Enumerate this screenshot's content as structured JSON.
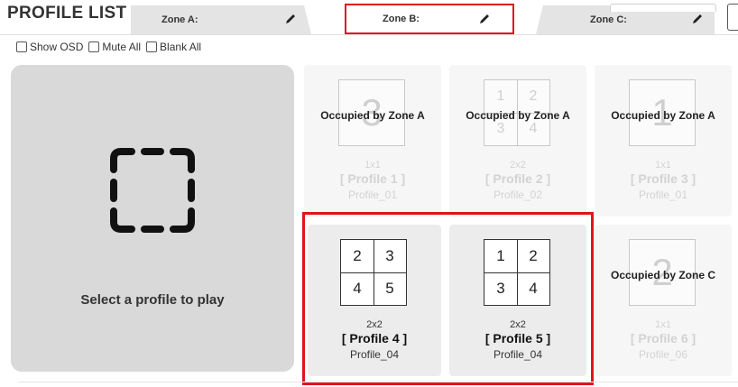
{
  "header": {
    "title": "PROFILE LIST"
  },
  "tabs": [
    {
      "label": "Zone A:"
    },
    {
      "label": "Zone B:"
    },
    {
      "label": "Zone C:"
    }
  ],
  "options": [
    {
      "label": "Show OSD",
      "checked": false
    },
    {
      "label": "Mute All",
      "checked": false
    },
    {
      "label": "Blank All",
      "checked": false
    }
  ],
  "player": {
    "caption": "Select a profile to play",
    "icon": "dashed-frame-icon"
  },
  "profiles": [
    {
      "name": "[ Profile 1 ]",
      "layout": "1x1",
      "sub": "Profile_01",
      "status": "Occupied by Zone A",
      "cells": [
        "3"
      ]
    },
    {
      "name": "[ Profile 2 ]",
      "layout": "2x2",
      "sub": "Profile_02",
      "status": "Occupied by Zone A",
      "cells": [
        "1",
        "2",
        "3",
        "4"
      ]
    },
    {
      "name": "[ Profile 3 ]",
      "layout": "1x1",
      "sub": "Profile_01",
      "status": "Occupied by Zone A",
      "cells": [
        "1"
      ]
    },
    {
      "name": "[ Profile 4 ]",
      "layout": "2x2",
      "sub": "Profile_04",
      "status": "",
      "cells": [
        "2",
        "3",
        "4",
        "5"
      ]
    },
    {
      "name": "[ Profile 5 ]",
      "layout": "2x2",
      "sub": "Profile_04",
      "status": "",
      "cells": [
        "1",
        "2",
        "3",
        "4"
      ]
    },
    {
      "name": "[ Profile 6 ]",
      "layout": "1x1",
      "sub": "Profile_06",
      "status": "Occupied by Zone C",
      "cells": [
        "2"
      ]
    }
  ],
  "colors": {
    "highlight": "#e0141c",
    "panel": "#d9d9d9",
    "tab": "#e4e4e4"
  }
}
